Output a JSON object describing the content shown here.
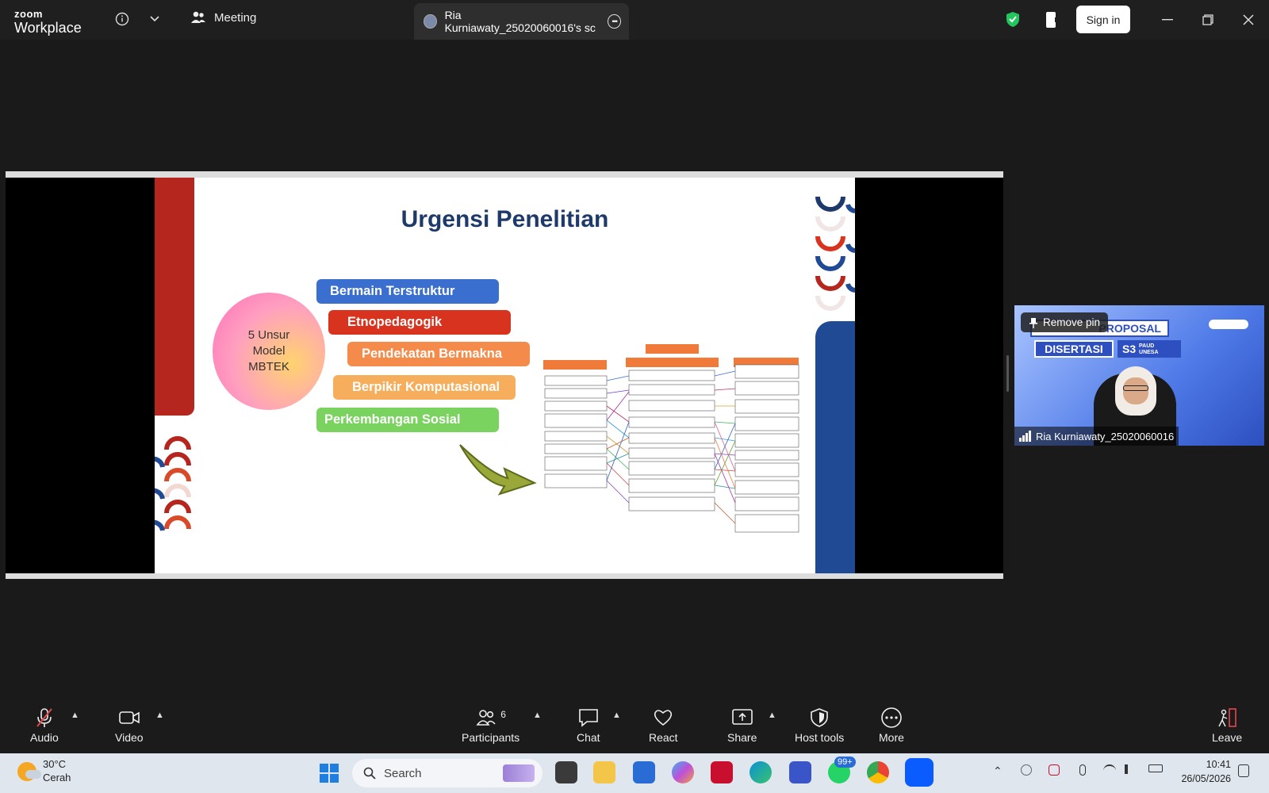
{
  "app": {
    "brand_line1": "zoom",
    "brand_line2": "Workplace"
  },
  "titlebar": {
    "meeting_label": "Meeting",
    "share_tab_label": "Ria Kurniawaty_25020060016's sc",
    "signin_label": "Sign in"
  },
  "slide": {
    "title": "Urgensi Penelitian",
    "circle_text": "5 Unsur Model MBTEK",
    "pills": [
      {
        "label": "Bermain Terstruktur",
        "color": "#3a6fd0"
      },
      {
        "label": "Etnopedagogik",
        "color": "#d8331f"
      },
      {
        "label": "Pendekatan Bermakna",
        "color": "#f58b4a"
      },
      {
        "label": "Berpikir Komputasional",
        "color": "#f7ae5c"
      },
      {
        "label": "Perkembangan Sosial",
        "color": "#7ad35f"
      }
    ]
  },
  "participant_tile": {
    "remove_pin_label": "Remove pin",
    "name": "Ria Kurniawaty_25020060016",
    "bg_line1": "PROPOSAL",
    "bg_line2": "DISERTASI",
    "bg_line3": "S3",
    "bg_line4": "PAUD UNESA"
  },
  "toolbar": {
    "audio": "Audio",
    "video": "Video",
    "participants": "Participants",
    "participants_count": "6",
    "chat": "Chat",
    "react": "React",
    "share": "Share",
    "host_tools": "Host tools",
    "more": "More",
    "leave": "Leave"
  },
  "taskbar": {
    "temperature": "30°C",
    "weather": "Cerah",
    "search_label": "Search",
    "notif_badge": "99+",
    "time": "10:41",
    "date": "26/05/2026"
  }
}
